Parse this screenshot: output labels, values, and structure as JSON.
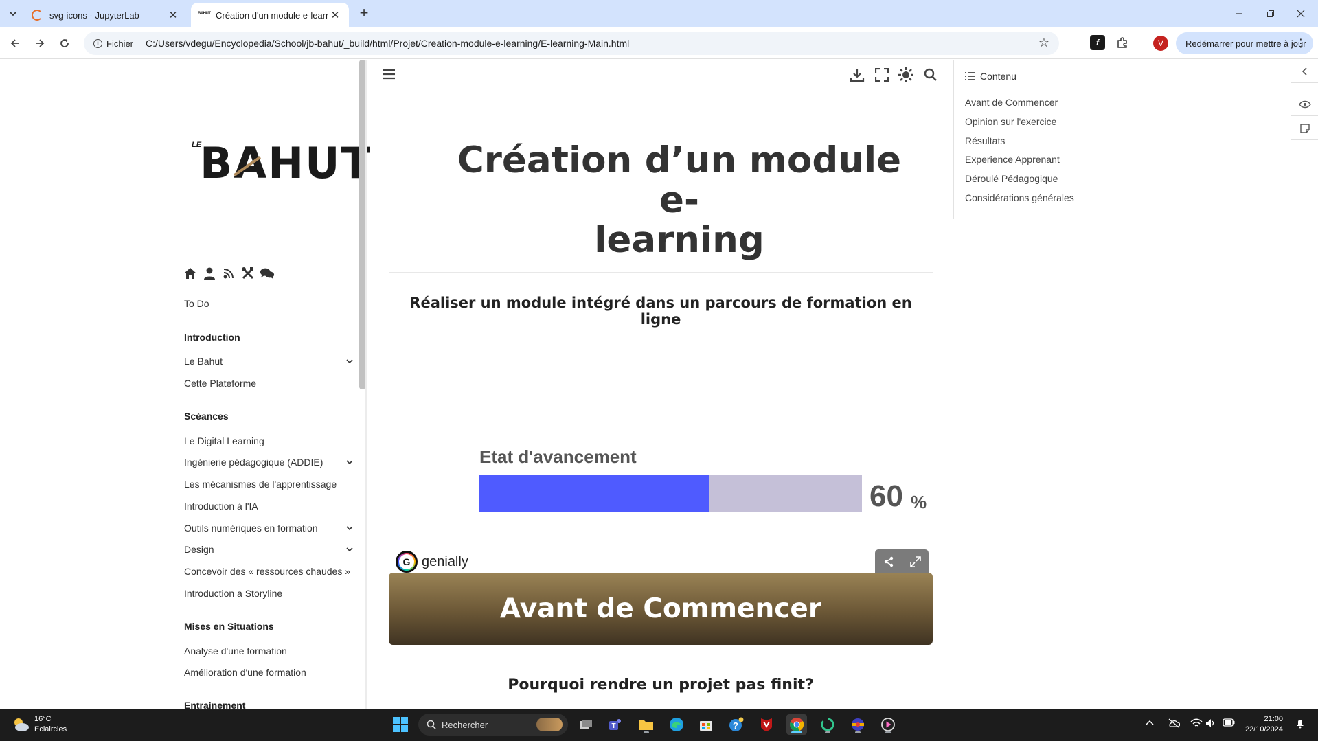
{
  "browser": {
    "tabs": [
      {
        "title": "svg-icons - JupyterLab",
        "active": false
      },
      {
        "title": "Création d'un module e-learnin",
        "active": true
      }
    ],
    "omnibox": {
      "chip_label": "Fichier",
      "url": "C:/Users/vdegu/Encyclopedia/School/jb-bahut/_build/html/Projet/Creation-module-e-learning/E-learning-Main.html"
    },
    "profile_initial": "V",
    "update_button_label": "Redémarrer pour mettre à jour"
  },
  "sidebar": {
    "logo_prefix": "LE",
    "logo_text": "BAHUT",
    "icons": [
      "home-icon",
      "user-icon",
      "podcast-icon",
      "tools-icon",
      "comments-icon"
    ],
    "top_link": "To Do",
    "sections": [
      {
        "caption": "Introduction",
        "items": [
          {
            "label": "Le Bahut",
            "expandable": true
          },
          {
            "label": "Cette Plateforme",
            "expandable": false
          }
        ]
      },
      {
        "caption": "Scéances",
        "items": [
          {
            "label": "Le Digital Learning",
            "expandable": false
          },
          {
            "label": "Ingénierie pédagogique (ADDIE)",
            "expandable": true
          },
          {
            "label": "Les mécanismes de l'apprentissage",
            "expandable": false
          },
          {
            "label": "Introduction à l'IA",
            "expandable": false
          },
          {
            "label": "Outils numériques en formation",
            "expandable": true
          },
          {
            "label": "Design",
            "expandable": true
          },
          {
            "label": "Concevoir des « ressources chaudes »",
            "expandable": false
          },
          {
            "label": "Introduction a Storyline",
            "expandable": false
          }
        ]
      },
      {
        "caption": "Mises en Situations",
        "items": [
          {
            "label": "Analyse d'une formation",
            "expandable": false
          },
          {
            "label": "Amélioration d'une formation",
            "expandable": false
          }
        ]
      },
      {
        "caption": "Entrainement",
        "items": []
      }
    ]
  },
  "main": {
    "header_icons": [
      "menu-icon",
      "download-icon",
      "fullscreen-icon",
      "theme-icon",
      "search-icon"
    ],
    "title": "Création d’un module e-learning",
    "title_line1": "Création d’un module e-",
    "title_line2": "learning",
    "subtitle": "Réaliser un module intégré dans un parcours de formation en ligne",
    "embed": {
      "progress_label": "Etat d'avancement",
      "progress_value": "60",
      "progress_fraction": 0.6,
      "progress_unit": "%",
      "brand": "genially",
      "fill_color": "#4f5bff",
      "track_color": "#c5c0d8"
    },
    "section_heading": "Avant de Commencer",
    "question_heading": "Pourquoi rendre un projet pas finit?"
  },
  "toc": {
    "title": "Contenu",
    "items": [
      "Avant de Commencer",
      "Opinion sur l'exercice",
      "Résultats",
      "Experience Apprenant",
      "Déroulé Pédagogique",
      "Considérations générales"
    ]
  },
  "taskbar": {
    "weather_temp": "16°C",
    "weather_desc": "Eclaircies",
    "search_placeholder": "Rechercher",
    "time": "21:00",
    "date": "22/10/2024"
  }
}
